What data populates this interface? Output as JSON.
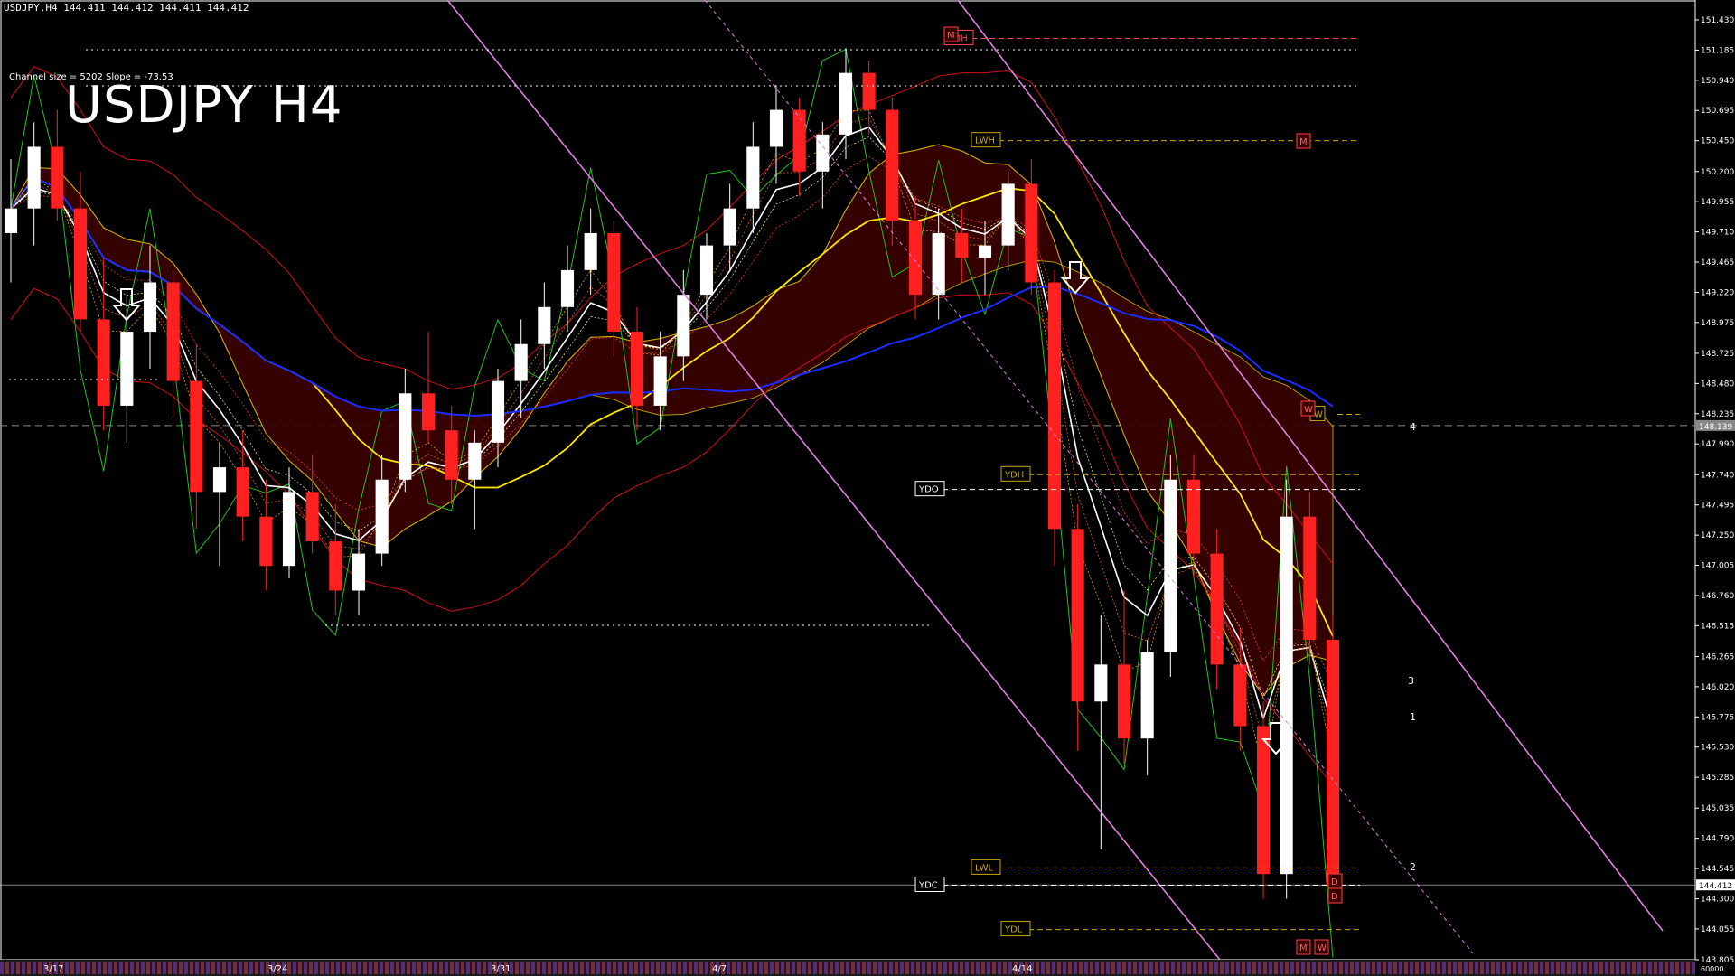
{
  "header": {
    "symbol_line": "USDJPY,H4  144.411 144.412 144.411 144.412",
    "channel_info": "Channel size = 5202 Slope = -73.53",
    "title": "USDJPY H4"
  },
  "colors": {
    "background": "#000000",
    "bull_candle": "#ffffff",
    "bear_candle": "#ff2020",
    "ma_white": "#ffffff",
    "ma_yellow": "#ffe600",
    "ma_blue": "#1a2cff",
    "chikou_green": "#1fc21f",
    "envelope_red": "#d01010",
    "cloud_yellow": "#c9a800",
    "channel_pink": "#e080e0",
    "grid_white": "#ffffff"
  },
  "chart_data": {
    "type": "candlestick",
    "title": "USDJPY H4",
    "ylim": [
      143.805,
      151.43
    ],
    "price_ticks": [
      "151.430",
      "151.185",
      "150.940",
      "150.695",
      "150.450",
      "150.200",
      "149.955",
      "149.710",
      "149.465",
      "149.220",
      "148.975",
      "148.725",
      "148.480",
      "148.235",
      "147.990",
      "147.740",
      "147.495",
      "147.250",
      "147.005",
      "146.760",
      "146.515",
      "146.265",
      "146.020",
      "145.775",
      "145.530",
      "145.285",
      "145.035",
      "144.790",
      "144.545",
      "144.300",
      "144.055",
      "143.805"
    ],
    "current_price": "144.412",
    "marked_price": "148.139",
    "date_labels": [
      "3/17",
      "3/24",
      "3/31",
      "4/7",
      "4/14"
    ],
    "ohlc_approx": [
      [
        149.7,
        150.3,
        149.3,
        149.9
      ],
      [
        149.9,
        150.6,
        149.6,
        150.4
      ],
      [
        150.4,
        150.7,
        149.8,
        149.9
      ],
      [
        149.9,
        150.2,
        148.9,
        149.0
      ],
      [
        149.0,
        149.5,
        148.1,
        148.3
      ],
      [
        148.3,
        149.2,
        148.0,
        148.9
      ],
      [
        148.9,
        149.6,
        148.6,
        149.3
      ],
      [
        149.3,
        149.4,
        148.2,
        148.5
      ],
      [
        148.5,
        148.8,
        147.3,
        147.6
      ],
      [
        147.6,
        148.0,
        147.0,
        147.8
      ],
      [
        147.8,
        148.1,
        147.2,
        147.4
      ],
      [
        147.4,
        147.7,
        146.8,
        147.0
      ],
      [
        147.0,
        147.8,
        146.9,
        147.6
      ],
      [
        147.6,
        147.9,
        147.1,
        147.2
      ],
      [
        147.2,
        147.5,
        146.6,
        146.8
      ],
      [
        146.8,
        147.3,
        146.6,
        147.1
      ],
      [
        147.1,
        147.9,
        147.0,
        147.7
      ],
      [
        147.7,
        148.6,
        147.6,
        148.4
      ],
      [
        148.4,
        148.9,
        148.0,
        148.1
      ],
      [
        148.1,
        148.3,
        147.5,
        147.7
      ],
      [
        147.7,
        148.1,
        147.3,
        148.0
      ],
      [
        148.0,
        148.6,
        147.8,
        148.5
      ],
      [
        148.5,
        149.0,
        148.2,
        148.8
      ],
      [
        148.8,
        149.3,
        148.6,
        149.1
      ],
      [
        149.1,
        149.6,
        148.9,
        149.4
      ],
      [
        149.4,
        149.9,
        149.2,
        149.7
      ],
      [
        149.7,
        149.8,
        148.7,
        148.9
      ],
      [
        148.9,
        149.1,
        148.1,
        148.3
      ],
      [
        148.3,
        148.9,
        148.1,
        148.7
      ],
      [
        148.7,
        149.4,
        148.5,
        149.2
      ],
      [
        149.2,
        149.7,
        149.0,
        149.6
      ],
      [
        149.6,
        150.1,
        149.4,
        149.9
      ],
      [
        149.9,
        150.6,
        149.7,
        150.4
      ],
      [
        150.4,
        150.9,
        150.1,
        150.7
      ],
      [
        150.7,
        150.8,
        150.0,
        150.2
      ],
      [
        150.2,
        150.6,
        149.9,
        150.5
      ],
      [
        150.5,
        151.2,
        150.3,
        151.0
      ],
      [
        151.0,
        151.1,
        150.5,
        150.7
      ],
      [
        150.7,
        150.8,
        149.6,
        149.8
      ],
      [
        149.8,
        150.0,
        149.0,
        149.2
      ],
      [
        149.2,
        149.9,
        149.0,
        149.7
      ],
      [
        149.7,
        149.9,
        149.3,
        149.5
      ],
      [
        149.5,
        149.8,
        149.2,
        149.6
      ],
      [
        149.6,
        150.2,
        149.4,
        150.1
      ],
      [
        150.1,
        150.3,
        149.2,
        149.3
      ],
      [
        149.3,
        149.4,
        147.0,
        147.3
      ],
      [
        147.3,
        147.5,
        145.5,
        145.9
      ],
      [
        145.9,
        146.6,
        144.7,
        146.2
      ],
      [
        146.2,
        146.8,
        145.4,
        145.6
      ],
      [
        145.6,
        146.4,
        145.3,
        146.3
      ],
      [
        146.3,
        147.9,
        146.1,
        147.7
      ],
      [
        147.7,
        147.9,
        146.9,
        147.1
      ],
      [
        147.1,
        147.3,
        146.0,
        146.2
      ],
      [
        146.2,
        146.5,
        145.5,
        145.7
      ],
      [
        145.7,
        145.9,
        144.3,
        144.5
      ],
      [
        144.5,
        147.7,
        144.3,
        147.4
      ],
      [
        147.4,
        147.6,
        146.2,
        146.4
      ],
      [
        146.4,
        146.6,
        144.5,
        144.4
      ]
    ],
    "horizontal_levels": [
      {
        "label": "LMH",
        "price": 151.28
      },
      {
        "label": "LWH",
        "price": 150.45
      },
      {
        "label": "YDO",
        "price": 147.62
      },
      {
        "label": "YDH",
        "price": 147.74
      },
      {
        "label": "LWL",
        "price": 144.55
      },
      {
        "label": "YDC",
        "price": 144.41
      },
      {
        "label": "YDL",
        "price": 144.05
      },
      {
        "label": "W",
        "price": 148.23
      }
    ],
    "projection_labels": [
      "4",
      "3",
      "1",
      "2"
    ],
    "markers": [
      "M",
      "M",
      "W",
      "D",
      "D",
      "M",
      "W"
    ]
  }
}
